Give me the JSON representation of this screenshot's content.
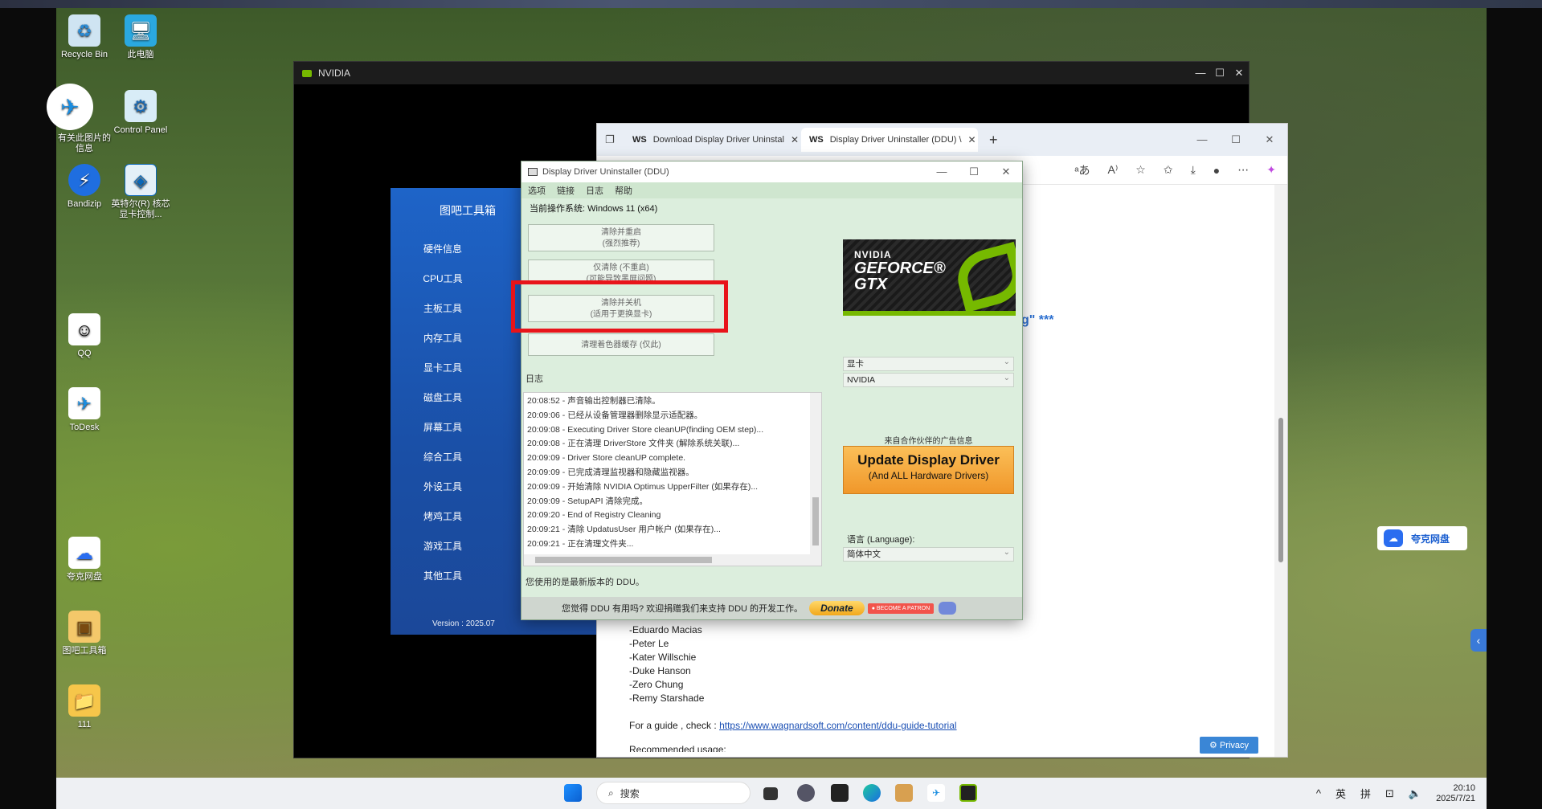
{
  "desktop": {
    "icons": [
      {
        "label": "Recycle Bin",
        "glyph": "♻"
      },
      {
        "label": "此电脑",
        "glyph": "🖥"
      },
      {
        "label": "有关此图片的信息",
        "glyph": "✈"
      },
      {
        "label": "Control Panel",
        "glyph": "⚙"
      },
      {
        "label": "Bandizip",
        "glyph": "⚡"
      },
      {
        "label": "英特尔(R) 核芯显卡控制...",
        "glyph": "◈"
      },
      {
        "label": "QQ",
        "glyph": "☺"
      },
      {
        "label": "ToDesk",
        "glyph": "✈"
      },
      {
        "label": "夸克网盘",
        "glyph": "☁"
      },
      {
        "label": "图吧工具箱",
        "glyph": "▣"
      },
      {
        "label": "111",
        "glyph": "📁"
      }
    ]
  },
  "nvidia_window": {
    "title": "NVIDIA"
  },
  "tuba": {
    "title": "图吧工具箱",
    "menu": [
      "硬件信息",
      "CPU工具",
      "主板工具",
      "内存工具",
      "显卡工具",
      "磁盘工具",
      "屏幕工具",
      "综合工具",
      "外设工具",
      "烤鸡工具",
      "游戏工具",
      "其他工具"
    ],
    "version": "Version : 2025.07"
  },
  "edge": {
    "tabs": [
      {
        "title": "Download Display Driver Uninstal"
      },
      {
        "title": "Display Driver Uninstaller (DDU) \\"
      }
    ],
    "headline_fragment": "g\" ***",
    "credits": [
      "-Eduardo Macias",
      "-Peter Le",
      "-Kater Willschie",
      "-Duke Hanson",
      "-Zero Chung",
      "-Remy Starshade"
    ],
    "guide_prefix": "For a guide , check :",
    "guide_link": "https://www.wagnardsoft.com/content/ddu-guide-tutorial",
    "bottom_text": "Recommended usage:",
    "privacy": "Privacy"
  },
  "ddu": {
    "title": "Display Driver Uninstaller (DDU)",
    "menu": [
      "选项",
      "链接",
      "日志",
      "帮助"
    ],
    "os_label": "当前操作系统: Windows 11 (x64)",
    "buttons": [
      {
        "line1": "清除并重启",
        "line2": "(强烈推荐)"
      },
      {
        "line1": "仅清除 (不重启)",
        "line2": "(可能导致黑屏问题)"
      },
      {
        "line1": "清除并关机",
        "line2": "(适用于更换显卡)"
      },
      {
        "line1": "清理着色器缓存 (仅此)",
        "line2": ""
      }
    ],
    "log_label": "日志",
    "log": [
      "20:08:52 - 声音输出控制器已清除。",
      "20:09:06 - 已经从设备管理器删除显示适配器。",
      "20:09:08 - Executing Driver Store cleanUP(finding OEM step)...",
      "20:09:08 - 正在清理 DriverStore 文件夹 (解除系统关联)...",
      "20:09:09 - Driver Store cleanUP complete.",
      "20:09:09 - 已完成清理监视器和隐藏监视器。",
      "20:09:09 - 开始清除 NVIDIA Optimus UpperFilter (如果存在)...",
      "20:09:09 - SetupAPI 清除完成。",
      "20:09:20 - End of Registry Cleaning",
      "20:09:21 - 清除 UpdatusUser 用户帐户 (如果存在)...",
      "20:09:21 - 正在清理文件夹..."
    ],
    "version_msg": "您使用的是最新版本的 DDU。",
    "logo": {
      "l1": "NVIDIA",
      "l2": "GEFORCE®",
      "l3": "GTX"
    },
    "device_type": "显卡",
    "vendor": "NVIDIA",
    "ad_label": "来自合作伙伴的广告信息",
    "ad_main": "Update Display Driver",
    "ad_sub": "(And ALL Hardware Drivers)",
    "lang_label": "语言 (Language):",
    "lang_value": "简体中文",
    "footer_text": "您觉得 DDU 有用吗? 欢迎捐赠我们来支持 DDU 的开发工作。",
    "donate": "Donate",
    "patreon": "BECOME A PATRON"
  },
  "taskbar": {
    "search_placeholder": "搜索",
    "tray": [
      "^",
      "英",
      "拼"
    ],
    "time": "20:10",
    "date": "2025/7/21"
  },
  "quark": {
    "label": "夸克网盘"
  },
  "colors": {
    "accent_red": "#e8141a",
    "nvidia_green": "#76b900",
    "tuba_blue": "#1e64c8"
  }
}
